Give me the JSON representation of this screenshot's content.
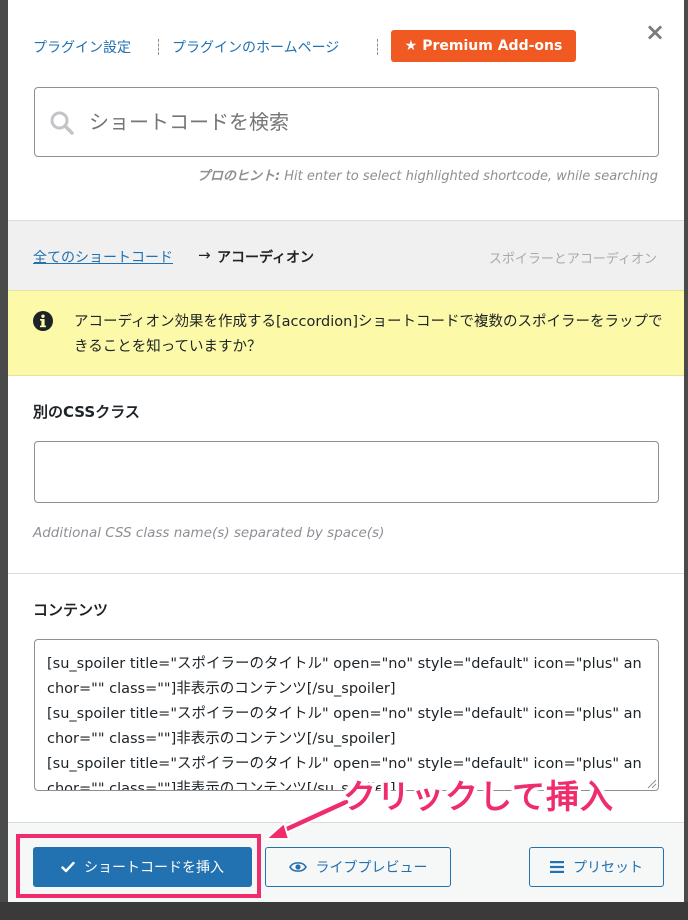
{
  "header": {
    "links": [
      "プラグイン設定",
      "プラグインのホームページ"
    ],
    "premium_label": "Premium Add-ons",
    "premium_star": "★",
    "close_label": "×"
  },
  "search": {
    "placeholder": "ショートコードを検索",
    "hint_prefix": "プロのヒント:",
    "hint_text": " Hit enter to select highlighted shortcode, while searching"
  },
  "breadcrumb": {
    "all_label": "全てのショートコード",
    "arrow": "→",
    "current": "アコーディオン",
    "description": "スポイラーとアコーディオン"
  },
  "notice": {
    "text": "アコーディオン効果を作成する[accordion]ショートコードで複数のスポイラーをラップできることを知っていますか？"
  },
  "fields": {
    "css_class": {
      "label": "別のCSSクラス",
      "value": "",
      "description": "Additional CSS class name(s) separated by space(s)"
    },
    "content": {
      "label": "コンテンツ",
      "value": "[su_spoiler title=\"スポイラーのタイトル\" open=\"no\" style=\"default\" icon=\"plus\" anchor=\"\" class=\"\"]非表示のコンテンツ[/su_spoiler]\n[su_spoiler title=\"スポイラーのタイトル\" open=\"no\" style=\"default\" icon=\"plus\" anchor=\"\" class=\"\"]非表示のコンテンツ[/su_spoiler]\n[su_spoiler title=\"スポイラーのタイトル\" open=\"no\" style=\"default\" icon=\"plus\" anchor=\"\" class=\"\"]非表示のコンテンツ[/su_spoiler]"
    }
  },
  "footer": {
    "insert_label": "ショートコードを挿入",
    "preview_label": "ライブプレビュー",
    "presets_label": "プリセット"
  },
  "annotation": {
    "text": "クリックして挿入"
  },
  "colors": {
    "primary": "#2271b1",
    "premium": "#f05a22",
    "notice_bg": "#fcf9a8",
    "annotation": "#ef2c6c"
  }
}
